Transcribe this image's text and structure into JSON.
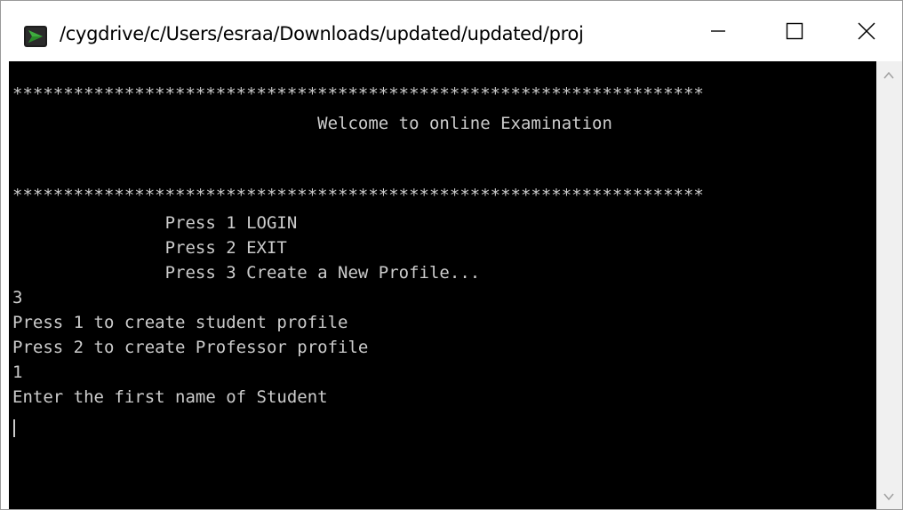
{
  "window": {
    "title": "/cygdrive/c/Users/esraa/Downloads/updated/updated/proj",
    "icon": "cygwin-terminal-icon",
    "controls": {
      "minimize": "minimize-icon",
      "maximize": "maximize-icon",
      "close": "close-icon"
    }
  },
  "terminal": {
    "background": "#000000",
    "foreground": "#cccccc",
    "lines": [
      "********************************************************************",
      "                              Welcome to online Examination",
      "",
      "",
      "********************************************************************",
      "               Press 1 LOGIN",
      "               Press 2 EXIT",
      "               Press 3 Create a New Profile...",
      "3",
      "Press 1 to create student profile",
      "Press 2 to create Professor profile",
      "1",
      "Enter the first name of Student"
    ]
  },
  "scrollbar": {
    "up": "scroll-up-arrow-icon",
    "down": "scroll-down-arrow-icon"
  }
}
